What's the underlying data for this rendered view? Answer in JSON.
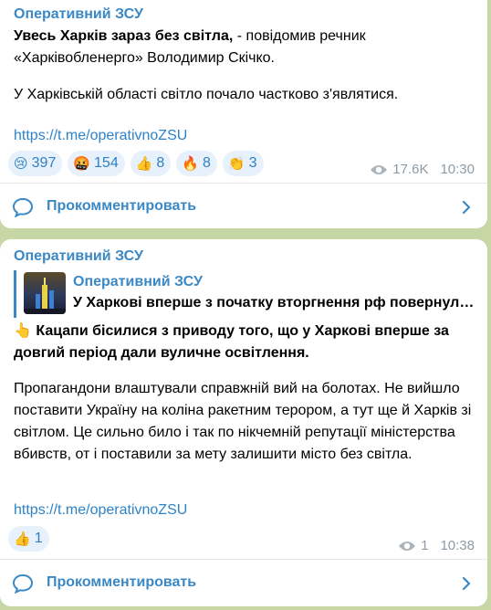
{
  "posts": [
    {
      "channel": "Оперативний ЗСУ",
      "lead_bold": "Увесь Харків зараз без світла,",
      "lead_rest": " - повідомив речник «Харківобленерго» Володимир Скічко.",
      "paragraph2": "У Харківській області світло почало частково з'являтися.",
      "link": "https://t.me/operativnoZSU",
      "reactions": [
        {
          "emoji": "😢",
          "icon": "crying-face-icon",
          "count": "397"
        },
        {
          "emoji": "🤬",
          "icon": "cursing-face-icon",
          "count": "154"
        },
        {
          "emoji": "👍",
          "icon": "thumbs-up-icon",
          "count": "8"
        },
        {
          "emoji": "🔥",
          "icon": "fire-icon",
          "count": "8"
        },
        {
          "emoji": "👏",
          "icon": "clapping-hands-icon",
          "count": "3"
        }
      ],
      "views": "17.6K",
      "time": "10:30",
      "comment_label": "Прокомментировать"
    },
    {
      "channel": "Оперативний ЗСУ",
      "quote": {
        "title": "Оперативний ЗСУ",
        "text": "У Харкові вперше з початку вторгнення рф повернули вуличне освітлення"
      },
      "lead_emoji": "👆",
      "lead_bold": "Кацапи бісилися з приводу того, що у Харкові вперше за довгий період дали вуличне освітлення.",
      "paragraph2": "Пропагандони влаштували справжній вий на болотах. Не вийшло поставити Україну на коліна ракетним терором, а тут ще й Харків зі світлом. Це сильно било і так по нікчемній репутації міністерства вбивств, от і поставили за мету залишити місто без світла.",
      "link": "https://t.me/operativnoZSU",
      "reactions": [
        {
          "emoji": "👍",
          "icon": "thumbs-up-icon",
          "count": "1"
        }
      ],
      "views": "1",
      "time": "10:38",
      "comment_label": "Прокомментировать"
    }
  ],
  "colors": {
    "background": "#c7d6a5",
    "accent": "#3a88c5",
    "link": "#2d83c9",
    "reaction_bg": "#e7f1fb",
    "meta": "#8e9aa5"
  }
}
